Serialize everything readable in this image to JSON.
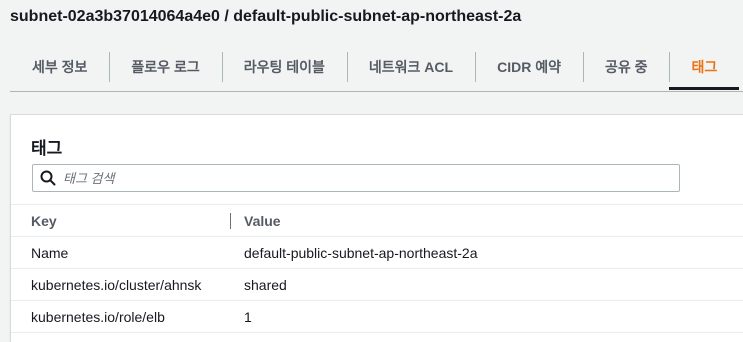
{
  "page": {
    "title": "subnet-02a3b37014064a4e0 / default-public-subnet-ap-northeast-2a"
  },
  "tabs": [
    {
      "label": "세부 정보",
      "active": false
    },
    {
      "label": "플로우 로그",
      "active": false
    },
    {
      "label": "라우팅 테이블",
      "active": false
    },
    {
      "label": "네트워크 ACL",
      "active": false
    },
    {
      "label": "CIDR 예약",
      "active": false
    },
    {
      "label": "공유 중",
      "active": false
    },
    {
      "label": "태그",
      "active": true
    }
  ],
  "panel": {
    "title": "태그",
    "search": {
      "placeholder": "태그 검색",
      "value": "",
      "icon": "search-icon"
    },
    "columns": {
      "key": "Key",
      "value": "Value"
    },
    "rows": [
      {
        "key": "Name",
        "value": "default-public-subnet-ap-northeast-2a"
      },
      {
        "key": "kubernetes.io/cluster/ahnsk",
        "value": "shared"
      },
      {
        "key": "kubernetes.io/role/elb",
        "value": "1"
      }
    ]
  },
  "colors": {
    "accent": "#ec7211",
    "text": "#16191f",
    "muted": "#545b64",
    "background": "#f2f3f3"
  }
}
